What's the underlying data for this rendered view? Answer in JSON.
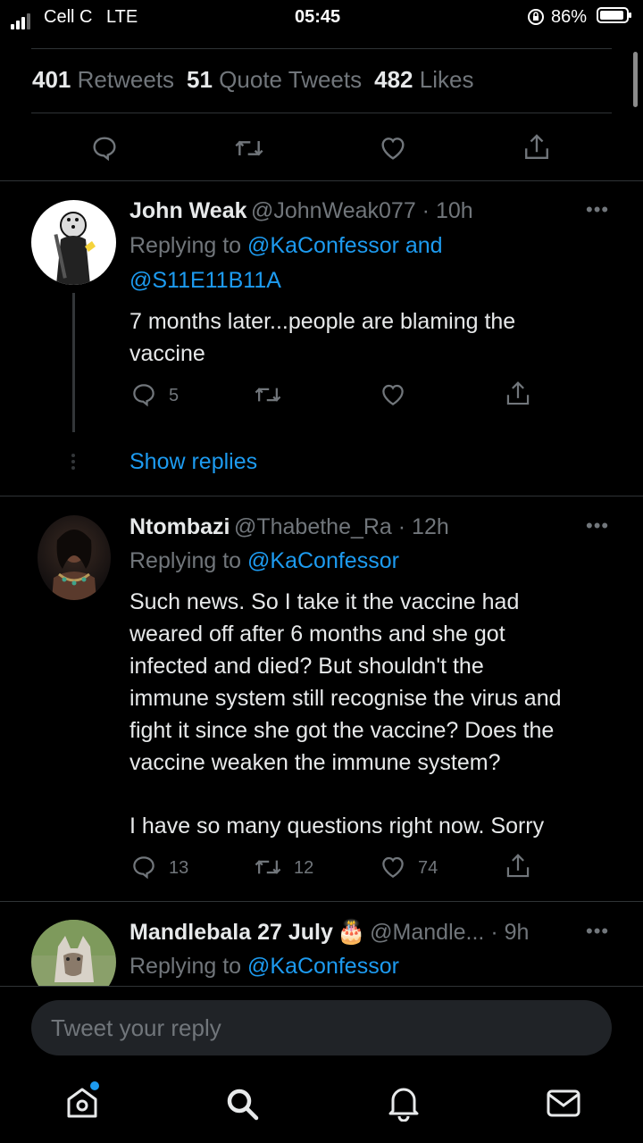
{
  "status_bar": {
    "carrier": "Cell C",
    "network": "LTE",
    "time": "05:45",
    "battery": "86%"
  },
  "stats": {
    "retweets_count": "401",
    "retweets_label": "Retweets",
    "quotes_count": "51",
    "quotes_label": "Quote Tweets",
    "likes_count": "482",
    "likes_label": "Likes"
  },
  "tweets": [
    {
      "name": "John Weak",
      "handle": "@JohnWeak077 · 10h",
      "replying_prefix": "Replying to",
      "replying_to_1": "@KaConfessor and",
      "replying_to_2": "@S11E11B11A",
      "text_lines": [
        "7 months later...people are blaming the",
        "vaccine"
      ],
      "reply_count": "5",
      "show_replies": "Show replies"
    },
    {
      "name": "Ntombazi",
      "handle": "@Thabethe_Ra · 12h",
      "replying_prefix": "Replying to",
      "replying_to_1": "@KaConfessor",
      "text_lines": [
        "Such news. So I take it the vaccine had",
        "weared off after 6 months and she got",
        "infected and died? But shouldn't the",
        "immune system still recognise the virus and",
        "fight it since she got the vaccine? Does the",
        "vaccine weaken the immune system?",
        "",
        "I have so many questions right now. Sorry"
      ],
      "reply_count": "13",
      "retweet_count": "12",
      "like_count": "74"
    },
    {
      "name": "Mandlebala 27 July",
      "name_emoji": "🎂",
      "handle": "@Mandle... · 9h",
      "replying_prefix": "Replying to",
      "replying_to_1": "@KaConfessor"
    }
  ],
  "reply_box": {
    "placeholder": "Tweet your reply"
  },
  "tab_bar": {
    "icons": [
      "home-icon",
      "search-icon",
      "notifications-icon",
      "messages-icon"
    ],
    "accent": "#1d9bf0"
  }
}
